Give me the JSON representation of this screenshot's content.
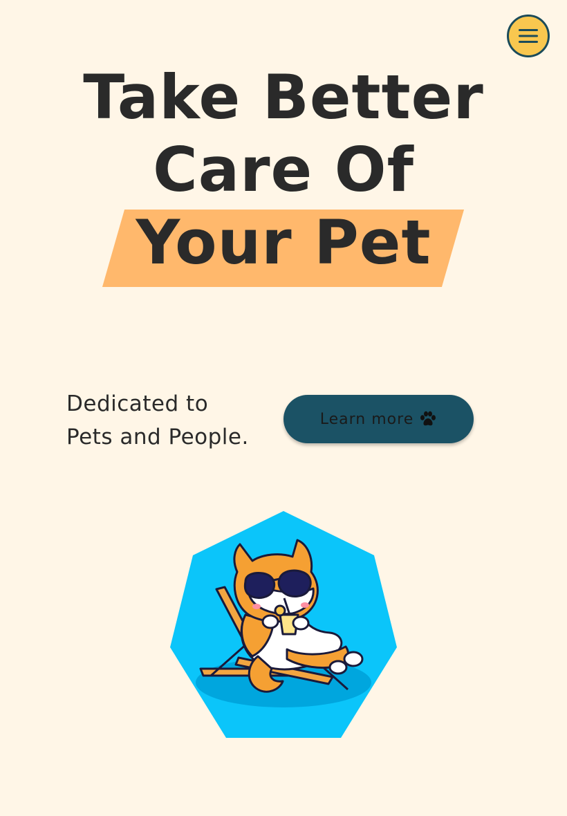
{
  "header": {
    "menu_icon": "hamburger-menu-icon"
  },
  "hero": {
    "title_line1": "Take Better",
    "title_line2": "Care Of",
    "title_highlight": "Your Pet",
    "highlight_color": "#FFB86C"
  },
  "tagline": {
    "line1": "Dedicated to",
    "line2": "Pets and People."
  },
  "cta": {
    "label": "Learn more",
    "icon": "paw-icon",
    "color": "#1B5265"
  },
  "illustration": {
    "shape_color": "#0BC5FA",
    "subject": "shiba-dog-sunglasses-beach-chair-illustration"
  },
  "colors": {
    "background": "#FFF6E7",
    "menu_button": "#F9C74F",
    "menu_border": "#1B4B5A"
  }
}
